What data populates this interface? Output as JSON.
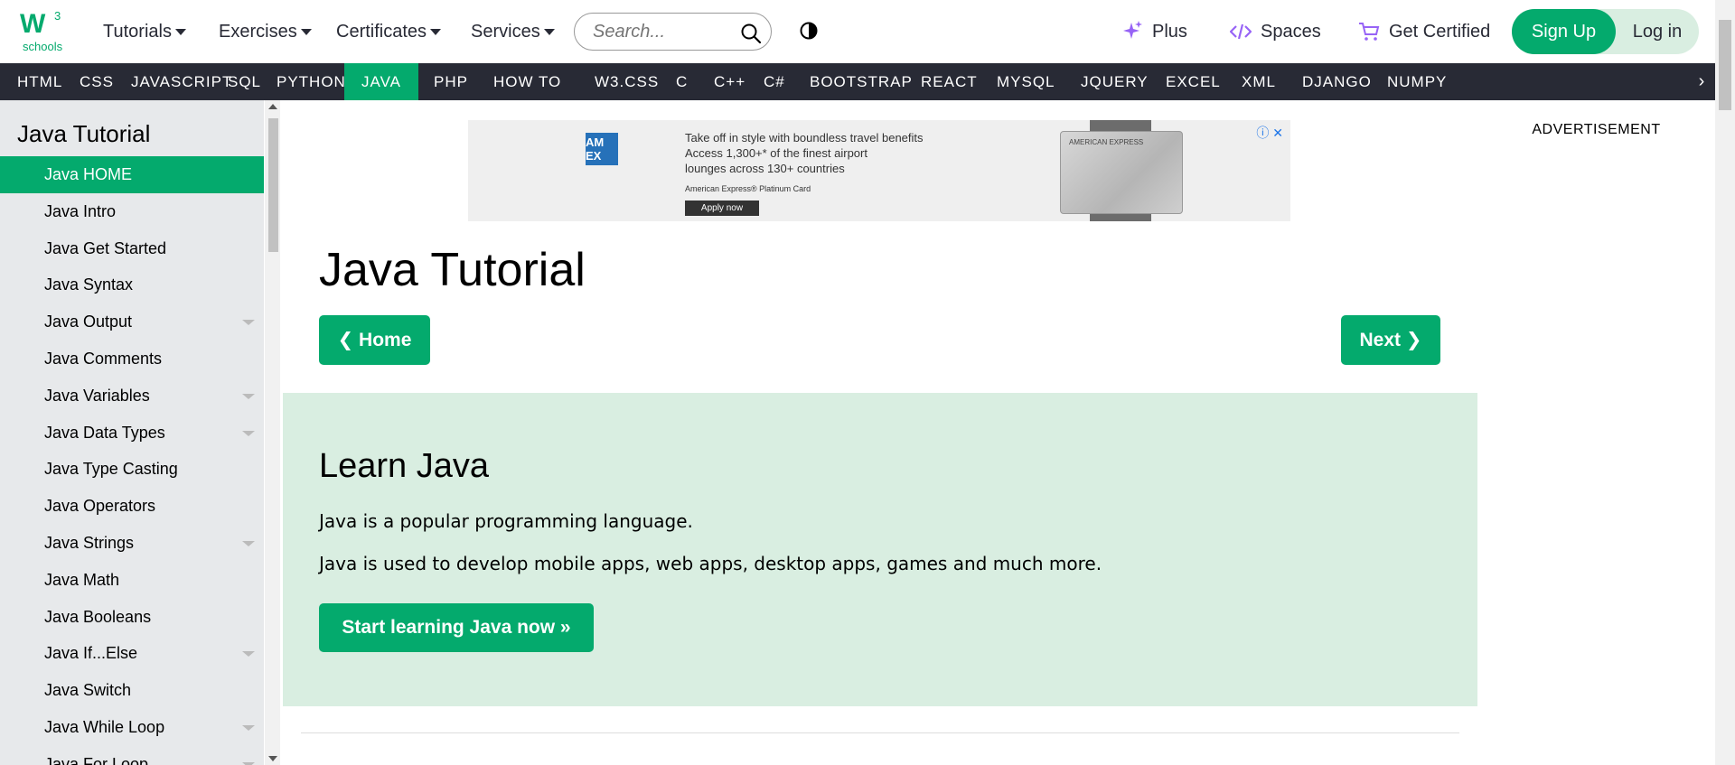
{
  "header": {
    "logo_text": "schools",
    "logo_superscript": "3",
    "menus": [
      {
        "label": "Tutorials"
      },
      {
        "label": "Exercises"
      },
      {
        "label": "Certificates"
      },
      {
        "label": "Services"
      }
    ],
    "search_placeholder": "Search...",
    "plus_label": "Plus",
    "spaces_label": "Spaces",
    "certified_label": "Get Certified",
    "signup_label": "Sign Up",
    "login_label": "Log in"
  },
  "nav": {
    "items": [
      "HTML",
      "CSS",
      "JAVASCRIPT",
      "SQL",
      "PYTHON",
      "JAVA",
      "PHP",
      "HOW TO",
      "W3.CSS",
      "C",
      "C++",
      "C#",
      "BOOTSTRAP",
      "REACT",
      "MYSQL",
      "JQUERY",
      "EXCEL",
      "XML",
      "DJANGO",
      "NUMPY"
    ],
    "active": "JAVA",
    "next_arrow": "›"
  },
  "sidebar": {
    "title": "Java Tutorial",
    "items": [
      {
        "label": "Java HOME",
        "active": true,
        "caret": false
      },
      {
        "label": "Java Intro",
        "caret": false
      },
      {
        "label": "Java Get Started",
        "caret": false
      },
      {
        "label": "Java Syntax",
        "caret": false
      },
      {
        "label": "Java Output",
        "caret": true
      },
      {
        "label": "Java Comments",
        "caret": false
      },
      {
        "label": "Java Variables",
        "caret": true
      },
      {
        "label": "Java Data Types",
        "caret": true
      },
      {
        "label": "Java Type Casting",
        "caret": false
      },
      {
        "label": "Java Operators",
        "caret": false
      },
      {
        "label": "Java Strings",
        "caret": true
      },
      {
        "label": "Java Math",
        "caret": false
      },
      {
        "label": "Java Booleans",
        "caret": false
      },
      {
        "label": "Java If...Else",
        "caret": true
      },
      {
        "label": "Java Switch",
        "caret": false
      },
      {
        "label": "Java While Loop",
        "caret": true
      },
      {
        "label": "Java For Loop",
        "caret": true
      }
    ]
  },
  "ad": {
    "logo": "AM EX",
    "line1": "Take off in style with boundless travel benefits",
    "line2": "Access 1,300+* of the finest airport",
    "line3": "lounges across 130+ countries",
    "line4": "American Express® Platinum Card",
    "apply": "Apply now",
    "card_text": "AMERICAN EXPRESS",
    "info": "ⓘ ✕"
  },
  "main": {
    "title": "Java Tutorial",
    "home_button": "❮ Home",
    "next_button": "Next ❯",
    "learn_title": "Learn Java",
    "p1": "Java is a popular programming language.",
    "p2": "Java is used to develop mobile apps, web apps, desktop apps, games and much more.",
    "start_button": "Start learning Java now »"
  },
  "right": {
    "ad_label": "ADVERTISEMENT"
  },
  "colors": {
    "brand_green": "#04aa6d",
    "nav_dark": "#282a35",
    "sidebar_bg": "#e7e9eb",
    "learn_bg": "#d9eee1",
    "accent_purple": "#9763f6"
  }
}
